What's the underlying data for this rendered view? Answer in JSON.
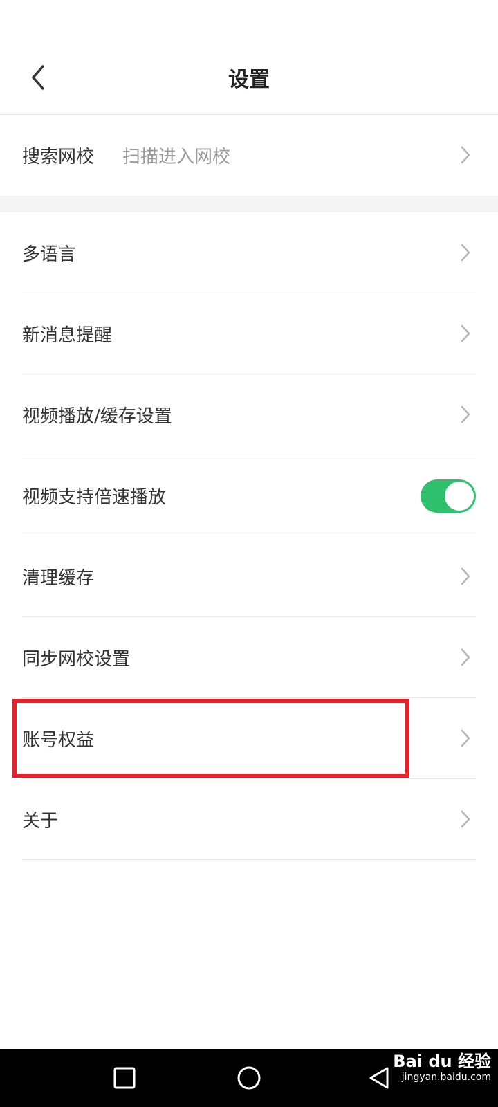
{
  "header": {
    "title": "设置"
  },
  "search_row": {
    "label": "搜索网校",
    "hint": "扫描进入网校"
  },
  "settings": [
    {
      "label": "多语言"
    },
    {
      "label": "新消息提醒"
    },
    {
      "label": "视频播放/缓存设置"
    },
    {
      "label": "视频支持倍速播放",
      "toggle": true
    },
    {
      "label": "清理缓存"
    },
    {
      "label": "同步网校设置"
    },
    {
      "label": "账号权益",
      "highlighted": true
    },
    {
      "label": "关于"
    }
  ],
  "colors": {
    "toggle_on": "#2fc16e",
    "highlight_box": "#e8202a",
    "navbar": "#000000"
  },
  "watermark": {
    "brand": "Bai du 经验",
    "site": "jingyan.baidu.com"
  }
}
